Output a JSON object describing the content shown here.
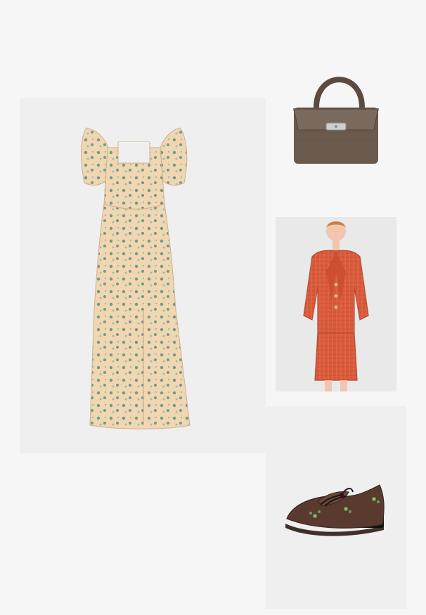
{
  "board": {
    "items": [
      {
        "id": "dress",
        "icon": "floral-midi-dress",
        "colors": {
          "base": "#f1d6b2",
          "pattern": "#6f9a88"
        }
      },
      {
        "id": "bag",
        "icon": "brown-top-handle-handbag",
        "colors": {
          "body": "#6a5a4e",
          "handle": "#5a4a40",
          "clasp": "#cfcfcf"
        }
      },
      {
        "id": "suit",
        "icon": "red-tweed-skirt-suit",
        "colors": {
          "fabric": "#d95b3c",
          "background": "#e9e9e9"
        }
      },
      {
        "id": "shoe",
        "icon": "brown-embroidered-loafer",
        "colors": {
          "upper": "#5a3a2f",
          "embroidery": "#5fa35a",
          "heel": "#111111"
        }
      }
    ]
  }
}
